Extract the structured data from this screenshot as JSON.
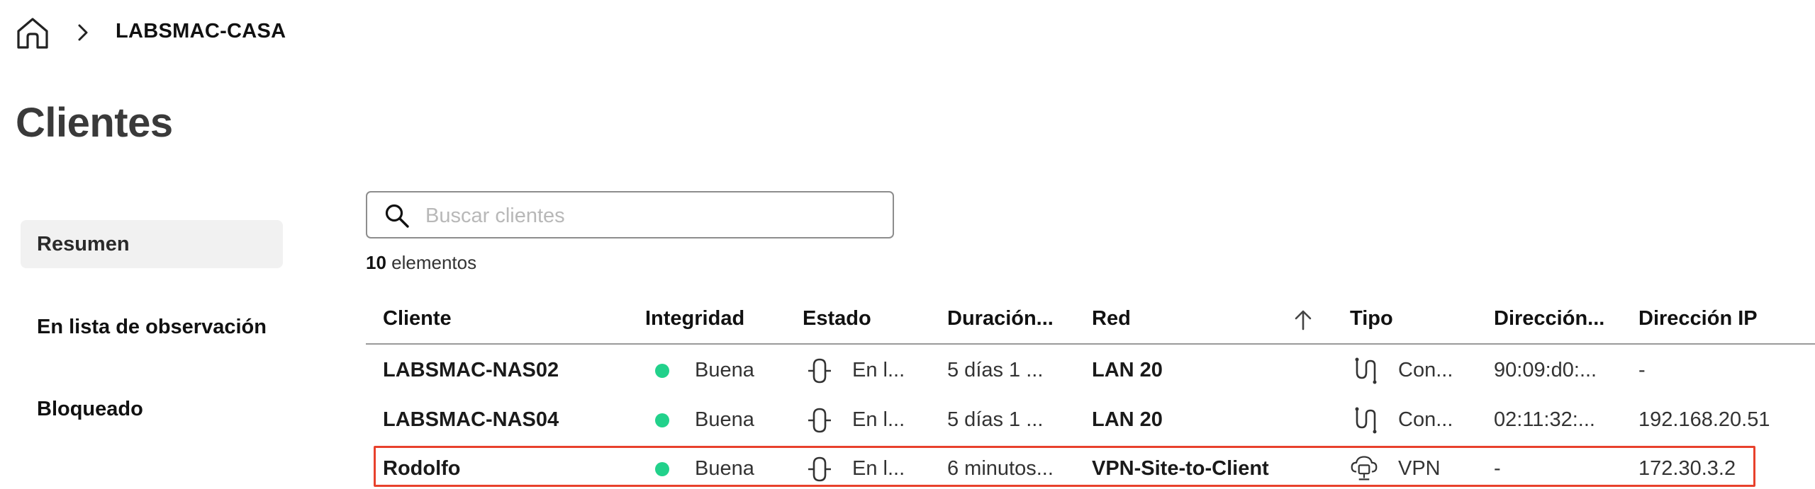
{
  "breadcrumb": {
    "current": "LABSMAC-CASA"
  },
  "page": {
    "title": "Clientes"
  },
  "nav": {
    "items": [
      {
        "label": "Resumen",
        "active": true
      },
      {
        "label": "En lista de observación",
        "active": false
      },
      {
        "label": "Bloqueado",
        "active": false
      }
    ]
  },
  "search": {
    "placeholder": "Buscar clientes",
    "value": ""
  },
  "count": {
    "number": "10",
    "label": "elementos"
  },
  "table": {
    "columns": [
      "Cliente",
      "Integridad",
      "Estado",
      "Duración...",
      "Red",
      "Tipo",
      "Dirección...",
      "Dirección IP"
    ],
    "sorted_column": "Red",
    "sort_direction": "ascending",
    "rows": [
      {
        "cliente": "LABSMAC-NAS02",
        "integridad": "Buena",
        "estado": "En l...",
        "duracion": "5 días 1 ...",
        "red": "LAN 20",
        "tipo": "Con...",
        "tipo_icon": "wired-icon",
        "mac": "90:09:d0:...",
        "ip": "-"
      },
      {
        "cliente": "LABSMAC-NAS04",
        "integridad": "Buena",
        "estado": "En l...",
        "duracion": "5 días 1 ...",
        "red": "LAN 20",
        "tipo": "Con...",
        "tipo_icon": "wired-icon",
        "mac": "02:11:32:...",
        "ip": "192.168.20.51"
      },
      {
        "cliente": "Rodolfo",
        "integridad": "Buena",
        "estado": "En l...",
        "duracion": "6 minutos...",
        "red": "VPN-Site-to-Client",
        "tipo": "VPN",
        "tipo_icon": "vpn-icon",
        "mac": "-",
        "ip": "172.30.3.2"
      }
    ]
  },
  "colors": {
    "health_good": "#22d18b",
    "highlight_border": "#e8412c"
  }
}
